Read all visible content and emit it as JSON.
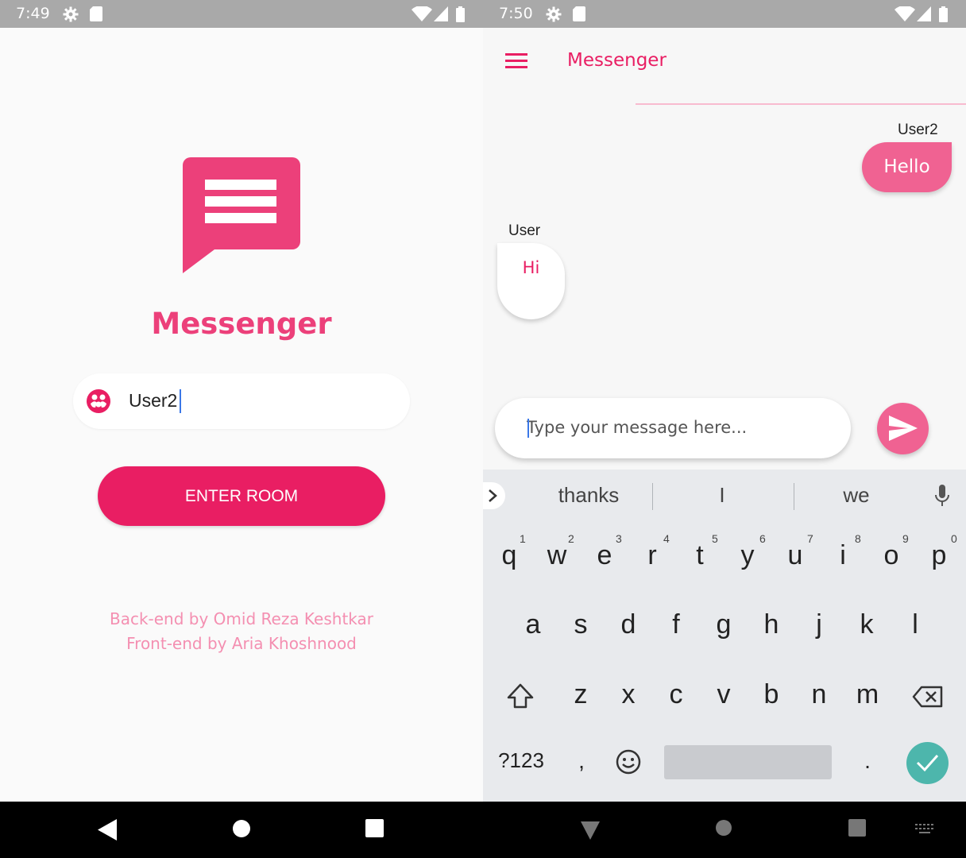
{
  "login": {
    "status_time": "7:49",
    "app_title": "Messenger",
    "username_value": "User2",
    "enter_button": "ENTER ROOM",
    "credits_backend": "Back-end by Omid Reza Keshtkar",
    "credits_frontend": "Front-end by Aria Khoshnood"
  },
  "chat": {
    "status_time": "7:50",
    "title": "Messenger",
    "messages": [
      {
        "sender": "User2",
        "text": "Hello",
        "direction": "outgoing"
      },
      {
        "sender": "User",
        "text": "Hi",
        "direction": "incoming"
      }
    ],
    "input_placeholder": "Type your message here...",
    "keyboard": {
      "suggestions": [
        "thanks",
        "I",
        "we"
      ],
      "row1": [
        "q",
        "w",
        "e",
        "r",
        "t",
        "y",
        "u",
        "i",
        "o",
        "p"
      ],
      "row1_hints": [
        "1",
        "2",
        "3",
        "4",
        "5",
        "6",
        "7",
        "8",
        "9",
        "0"
      ],
      "row2": [
        "a",
        "s",
        "d",
        "f",
        "g",
        "h",
        "j",
        "k",
        "l"
      ],
      "row3": [
        "z",
        "x",
        "c",
        "v",
        "b",
        "n",
        "m"
      ],
      "symbols_key": "?123",
      "comma_key": ",",
      "period_key": "."
    }
  },
  "colors": {
    "brand_pink": "#ec407a",
    "button_pink": "#e91e63",
    "bubble_pink": "#f06292",
    "credits_pink": "#f48fb1",
    "done_teal": "#4db6ac"
  }
}
